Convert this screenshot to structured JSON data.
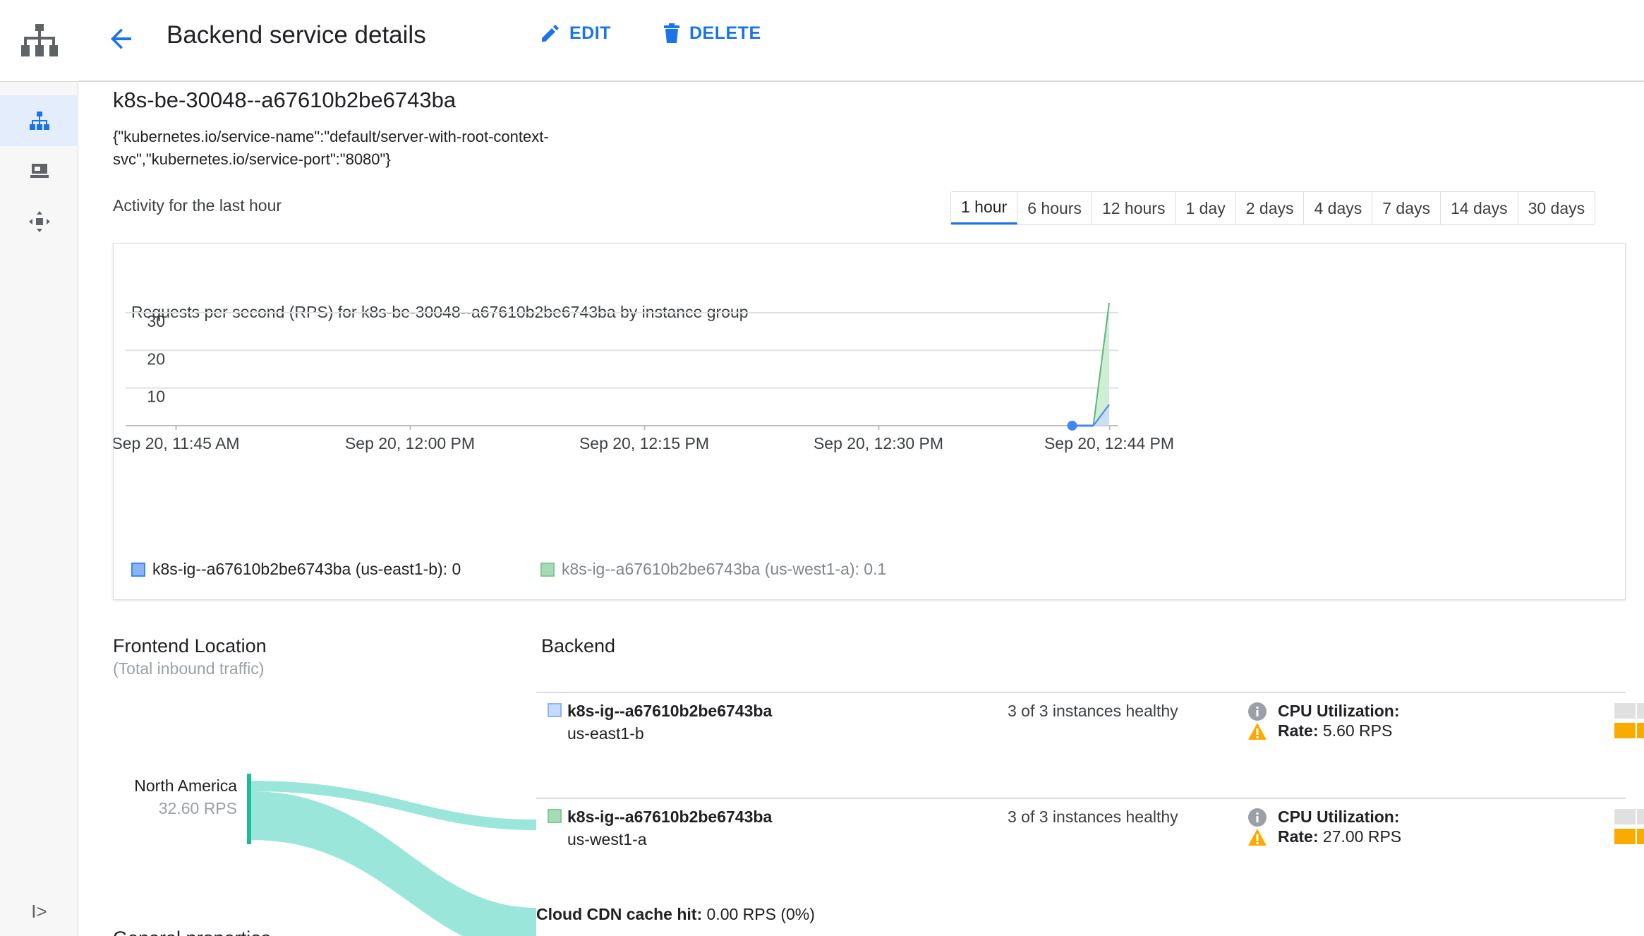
{
  "header": {
    "title": "Backend service details",
    "edit_label": "EDIT",
    "delete_label": "DELETE"
  },
  "service": {
    "name": "k8s-be-30048--a67610b2be6743ba",
    "description": "{\"kubernetes.io/service-name\":\"default/server-with-root-context-svc\",\"kubernetes.io/service-port\":\"8080\"}"
  },
  "activity_label": "Activity for the last hour",
  "ranges": [
    {
      "label": "1 hour",
      "active": true
    },
    {
      "label": "6 hours"
    },
    {
      "label": "12 hours"
    },
    {
      "label": "1 day"
    },
    {
      "label": "2 days"
    },
    {
      "label": "4 days"
    },
    {
      "label": "7 days"
    },
    {
      "label": "14 days"
    },
    {
      "label": "30 days"
    }
  ],
  "chart_data": {
    "type": "area",
    "title": "Requests per second (RPS) for k8s-be-30048--a67610b2be6743ba by instance group",
    "x_labels": [
      "Sep 20, 11:45 AM",
      "Sep 20, 12:00 PM",
      "Sep 20, 12:15 PM",
      "Sep 20, 12:30 PM",
      "Sep 20, 12:44 PM"
    ],
    "y_ticks": [
      10,
      20,
      30
    ],
    "ylim": [
      0,
      30
    ],
    "series": [
      {
        "name": "k8s-ig--a67610b2be6743ba (us-east1-b)",
        "legend_value": "0",
        "color": "#4285f4",
        "fill": "#c9dcfb",
        "points": [
          [
            "Sep 20, 12:43 PM",
            0
          ],
          [
            "Sep 20, 12:44 PM",
            5.6
          ]
        ]
      },
      {
        "name": "k8s-ig--a67610b2be6743ba (us-west1-a)",
        "legend_value": "0.1",
        "color": "#5bb974",
        "fill": "#c8ebcf",
        "points": [
          [
            "Sep 20, 12:43 PM",
            0
          ],
          [
            "Sep 20, 12:44 PM",
            32.6
          ]
        ]
      }
    ],
    "legend": [
      "k8s-ig--a67610b2be6743ba (us-east1-b): 0",
      "k8s-ig--a67610b2be6743ba (us-west1-a): 0.1"
    ]
  },
  "frontend": {
    "title": "Frontend Location",
    "subtitle": "(Total inbound traffic)",
    "region": "North America",
    "region_rps": "32.60 RPS"
  },
  "backend": {
    "title": "Backend",
    "rows": [
      {
        "name": "k8s-ig--a67610b2be6743ba",
        "zone": "us-east1-b",
        "health": "3 of 3 instances healthy",
        "cpu_label": "CPU Utilization:",
        "rate_label": "Rate:",
        "rate_value": "5.60 RPS",
        "color": "#8ab4f8"
      },
      {
        "name": "k8s-ig--a67610b2be6743ba",
        "zone": "us-west1-a",
        "health": "3 of 3 instances healthy",
        "cpu_label": "CPU Utilization:",
        "rate_label": "Rate:",
        "rate_value": "27.00 RPS",
        "color": "#81c995"
      }
    ]
  },
  "cdn": {
    "label": "Cloud CDN cache hit:",
    "value": "0.00 RPS (0%)"
  },
  "general_properties": "General properties"
}
